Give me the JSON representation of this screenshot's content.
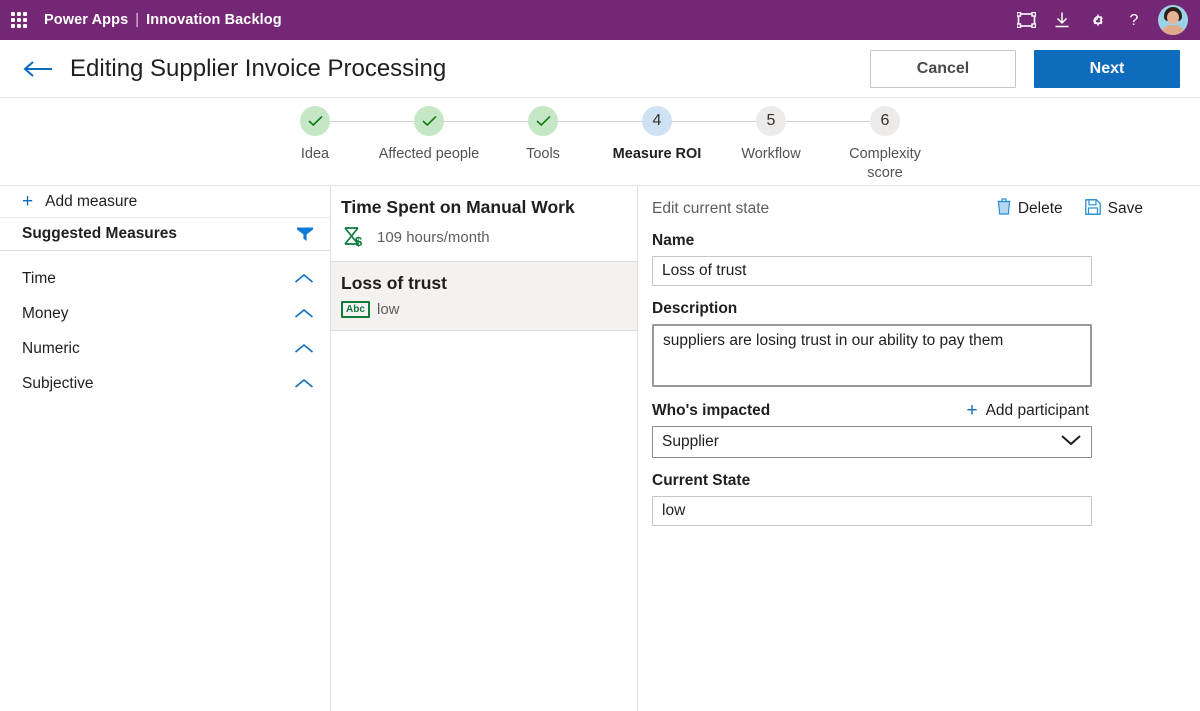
{
  "suitebar": {
    "app_name": "Power Apps",
    "separator": "|",
    "environment": "Innovation Backlog",
    "icons": [
      {
        "name": "screen-frame-icon",
        "label": "Display"
      },
      {
        "name": "download-icon",
        "label": "Download"
      },
      {
        "name": "gear-icon",
        "label": "Settings"
      },
      {
        "name": "help-icon",
        "label": "Help"
      }
    ],
    "avatar_name": "user-avatar",
    "brand_color": "#742774"
  },
  "commandbar": {
    "back_icon": "back-arrow-icon",
    "title": "Editing Supplier Invoice Processing",
    "cancel_label": "Cancel",
    "next_label": "Next",
    "primary_color": "#0f6cbd"
  },
  "stepper": {
    "steps": [
      {
        "number": "1",
        "label": "Idea",
        "state": "done",
        "mark": "✓"
      },
      {
        "number": "2",
        "label": "Affected people",
        "state": "done",
        "mark": "✓"
      },
      {
        "number": "3",
        "label": "Tools",
        "state": "done",
        "mark": "✓"
      },
      {
        "number": "4",
        "label": "Measure ROI",
        "state": "active",
        "mark": "4"
      },
      {
        "number": "5",
        "label": "Workflow",
        "state": "todo",
        "mark": "5"
      },
      {
        "number": "6",
        "label": "Complexity score",
        "state": "todo",
        "mark": "6"
      }
    ],
    "done_color": "#c6e7c6",
    "active_color": "#cfe2f3",
    "todo_color": "#edebe9"
  },
  "sidebar": {
    "add_measure_label": "Add measure",
    "add_measure_icon": "plus-icon",
    "suggested_title": "Suggested Measures",
    "filter_icon": "filter-icon",
    "categories": [
      {
        "label": "Time",
        "icon": "chevron-up-icon"
      },
      {
        "label": "Money",
        "icon": "chevron-up-icon"
      },
      {
        "label": "Numeric",
        "icon": "chevron-up-icon"
      },
      {
        "label": "Subjective",
        "icon": "chevron-up-icon"
      }
    ]
  },
  "measures": [
    {
      "name": "Time Spent on Manual Work",
      "value": "109 hours/month",
      "icon": "hourglass-dollar-icon",
      "selected": false
    },
    {
      "name": "Loss of trust",
      "value": "low",
      "icon": "abc-icon",
      "icon_text": "Abc",
      "selected": true
    }
  ],
  "detail": {
    "subtitle": "Edit current state",
    "delete_label": "Delete",
    "delete_icon": "trash-icon",
    "save_label": "Save",
    "save_icon": "save-disk-icon",
    "name_label": "Name",
    "name_value": "Loss of trust",
    "description_label": "Description",
    "description_value": "suppliers are losing trust in our ability to pay them",
    "impacted_label": "Who's impacted",
    "add_participant_label": "Add participant",
    "add_participant_icon": "plus-icon",
    "participant_value": "Supplier",
    "participant_chevron": "chevron-down-icon",
    "current_state_label": "Current State",
    "current_state_value": "low"
  }
}
